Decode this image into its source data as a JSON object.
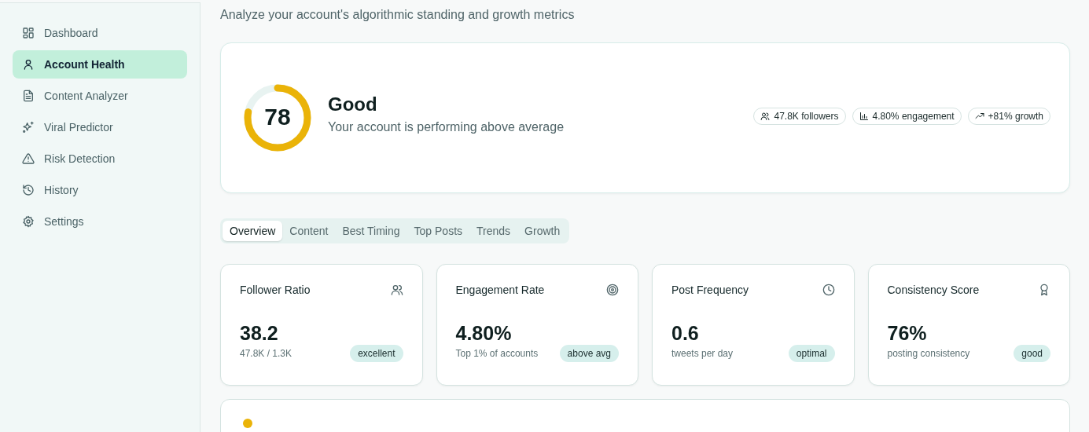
{
  "sidebar": {
    "items": [
      {
        "label": "Dashboard",
        "selected": false
      },
      {
        "label": "Account Health",
        "selected": true
      },
      {
        "label": "Content Analyzer",
        "selected": false
      },
      {
        "label": "Viral Predictor",
        "selected": false
      },
      {
        "label": "Risk Detection",
        "selected": false
      },
      {
        "label": "History",
        "selected": false
      },
      {
        "label": "Settings",
        "selected": false
      }
    ]
  },
  "subtitle": "Analyze your account's algorithmic standing and growth metrics",
  "score": {
    "value": "78",
    "level": 0.78,
    "rating": "Good",
    "description": "Your account is performing above average",
    "pills": [
      "47.8K followers",
      "4.80% engagement",
      "+81% growth"
    ]
  },
  "tabs": [
    {
      "label": "Overview",
      "selected": true
    },
    {
      "label": "Content",
      "selected": false
    },
    {
      "label": "Best Timing",
      "selected": false
    },
    {
      "label": "Top Posts",
      "selected": false
    },
    {
      "label": "Trends",
      "selected": false
    },
    {
      "label": "Growth",
      "selected": false
    }
  ],
  "metrics": [
    {
      "title": "Follower Ratio",
      "value": "38.2",
      "detail": "47.8K / 1.3K",
      "badge": "excellent"
    },
    {
      "title": "Engagement Rate",
      "value": "4.80%",
      "detail": "Top 1% of accounts",
      "badge": "above avg"
    },
    {
      "title": "Post Frequency",
      "value": "0.6",
      "detail": "tweets per day",
      "badge": "optimal"
    },
    {
      "title": "Consistency Score",
      "value": "76%",
      "detail": "posting consistency",
      "badge": "good"
    }
  ]
}
